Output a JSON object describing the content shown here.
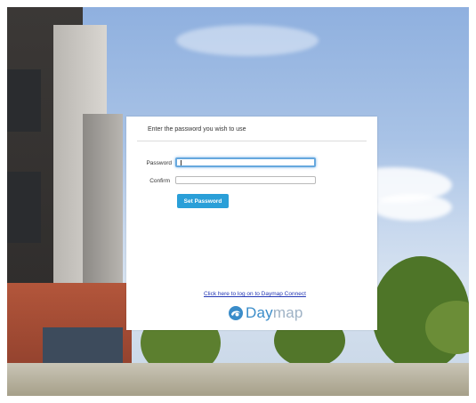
{
  "form": {
    "heading": "Enter the password you wish to use",
    "password_label": "Password",
    "password_value": "",
    "confirm_label": "Confirm",
    "confirm_value": "",
    "submit_label": "Set Password"
  },
  "footer": {
    "link_text": "Click here to log on to Daymap Connect",
    "logo_text_dark": "Day",
    "logo_text_light": "map"
  },
  "colors": {
    "button": "#2a9fd8",
    "link": "#2437b5",
    "logo": "#3a8cc9",
    "focus_ring": "#66a8de"
  },
  "icons": {
    "logo": "daymap-swirl-icon"
  }
}
